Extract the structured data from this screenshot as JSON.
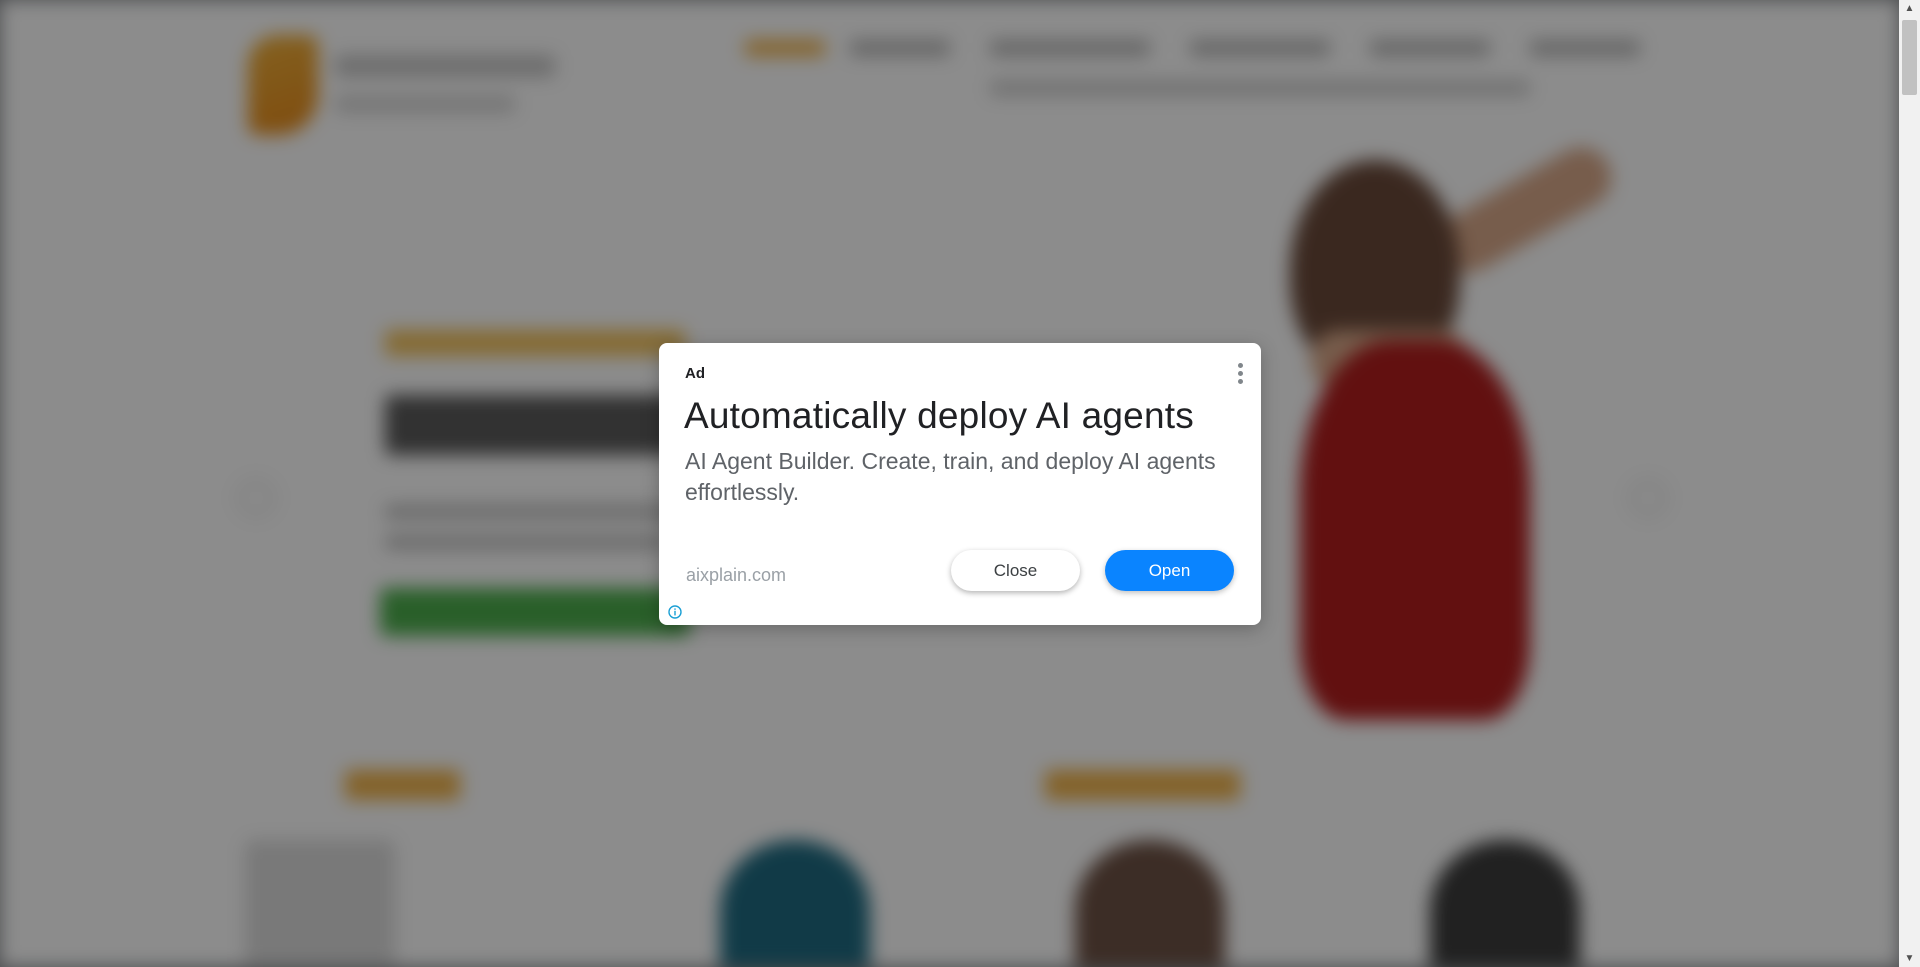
{
  "ad": {
    "label": "Ad",
    "title": "Automatically deploy AI agents",
    "description": "AI Agent Builder. Create, train, and deploy AI agents effortlessly.",
    "domain": "aixplain.com",
    "close_label": "Close",
    "open_label": "Open",
    "menu_icon": "more-vert-icon",
    "info_icon": "info-icon"
  },
  "colors": {
    "open_button": "#0a84ff",
    "info_icon": "#1a9fd4",
    "overlay": "#8a8d91"
  },
  "scrollbar": {
    "up_glyph": "▲",
    "down_glyph": "▼"
  }
}
